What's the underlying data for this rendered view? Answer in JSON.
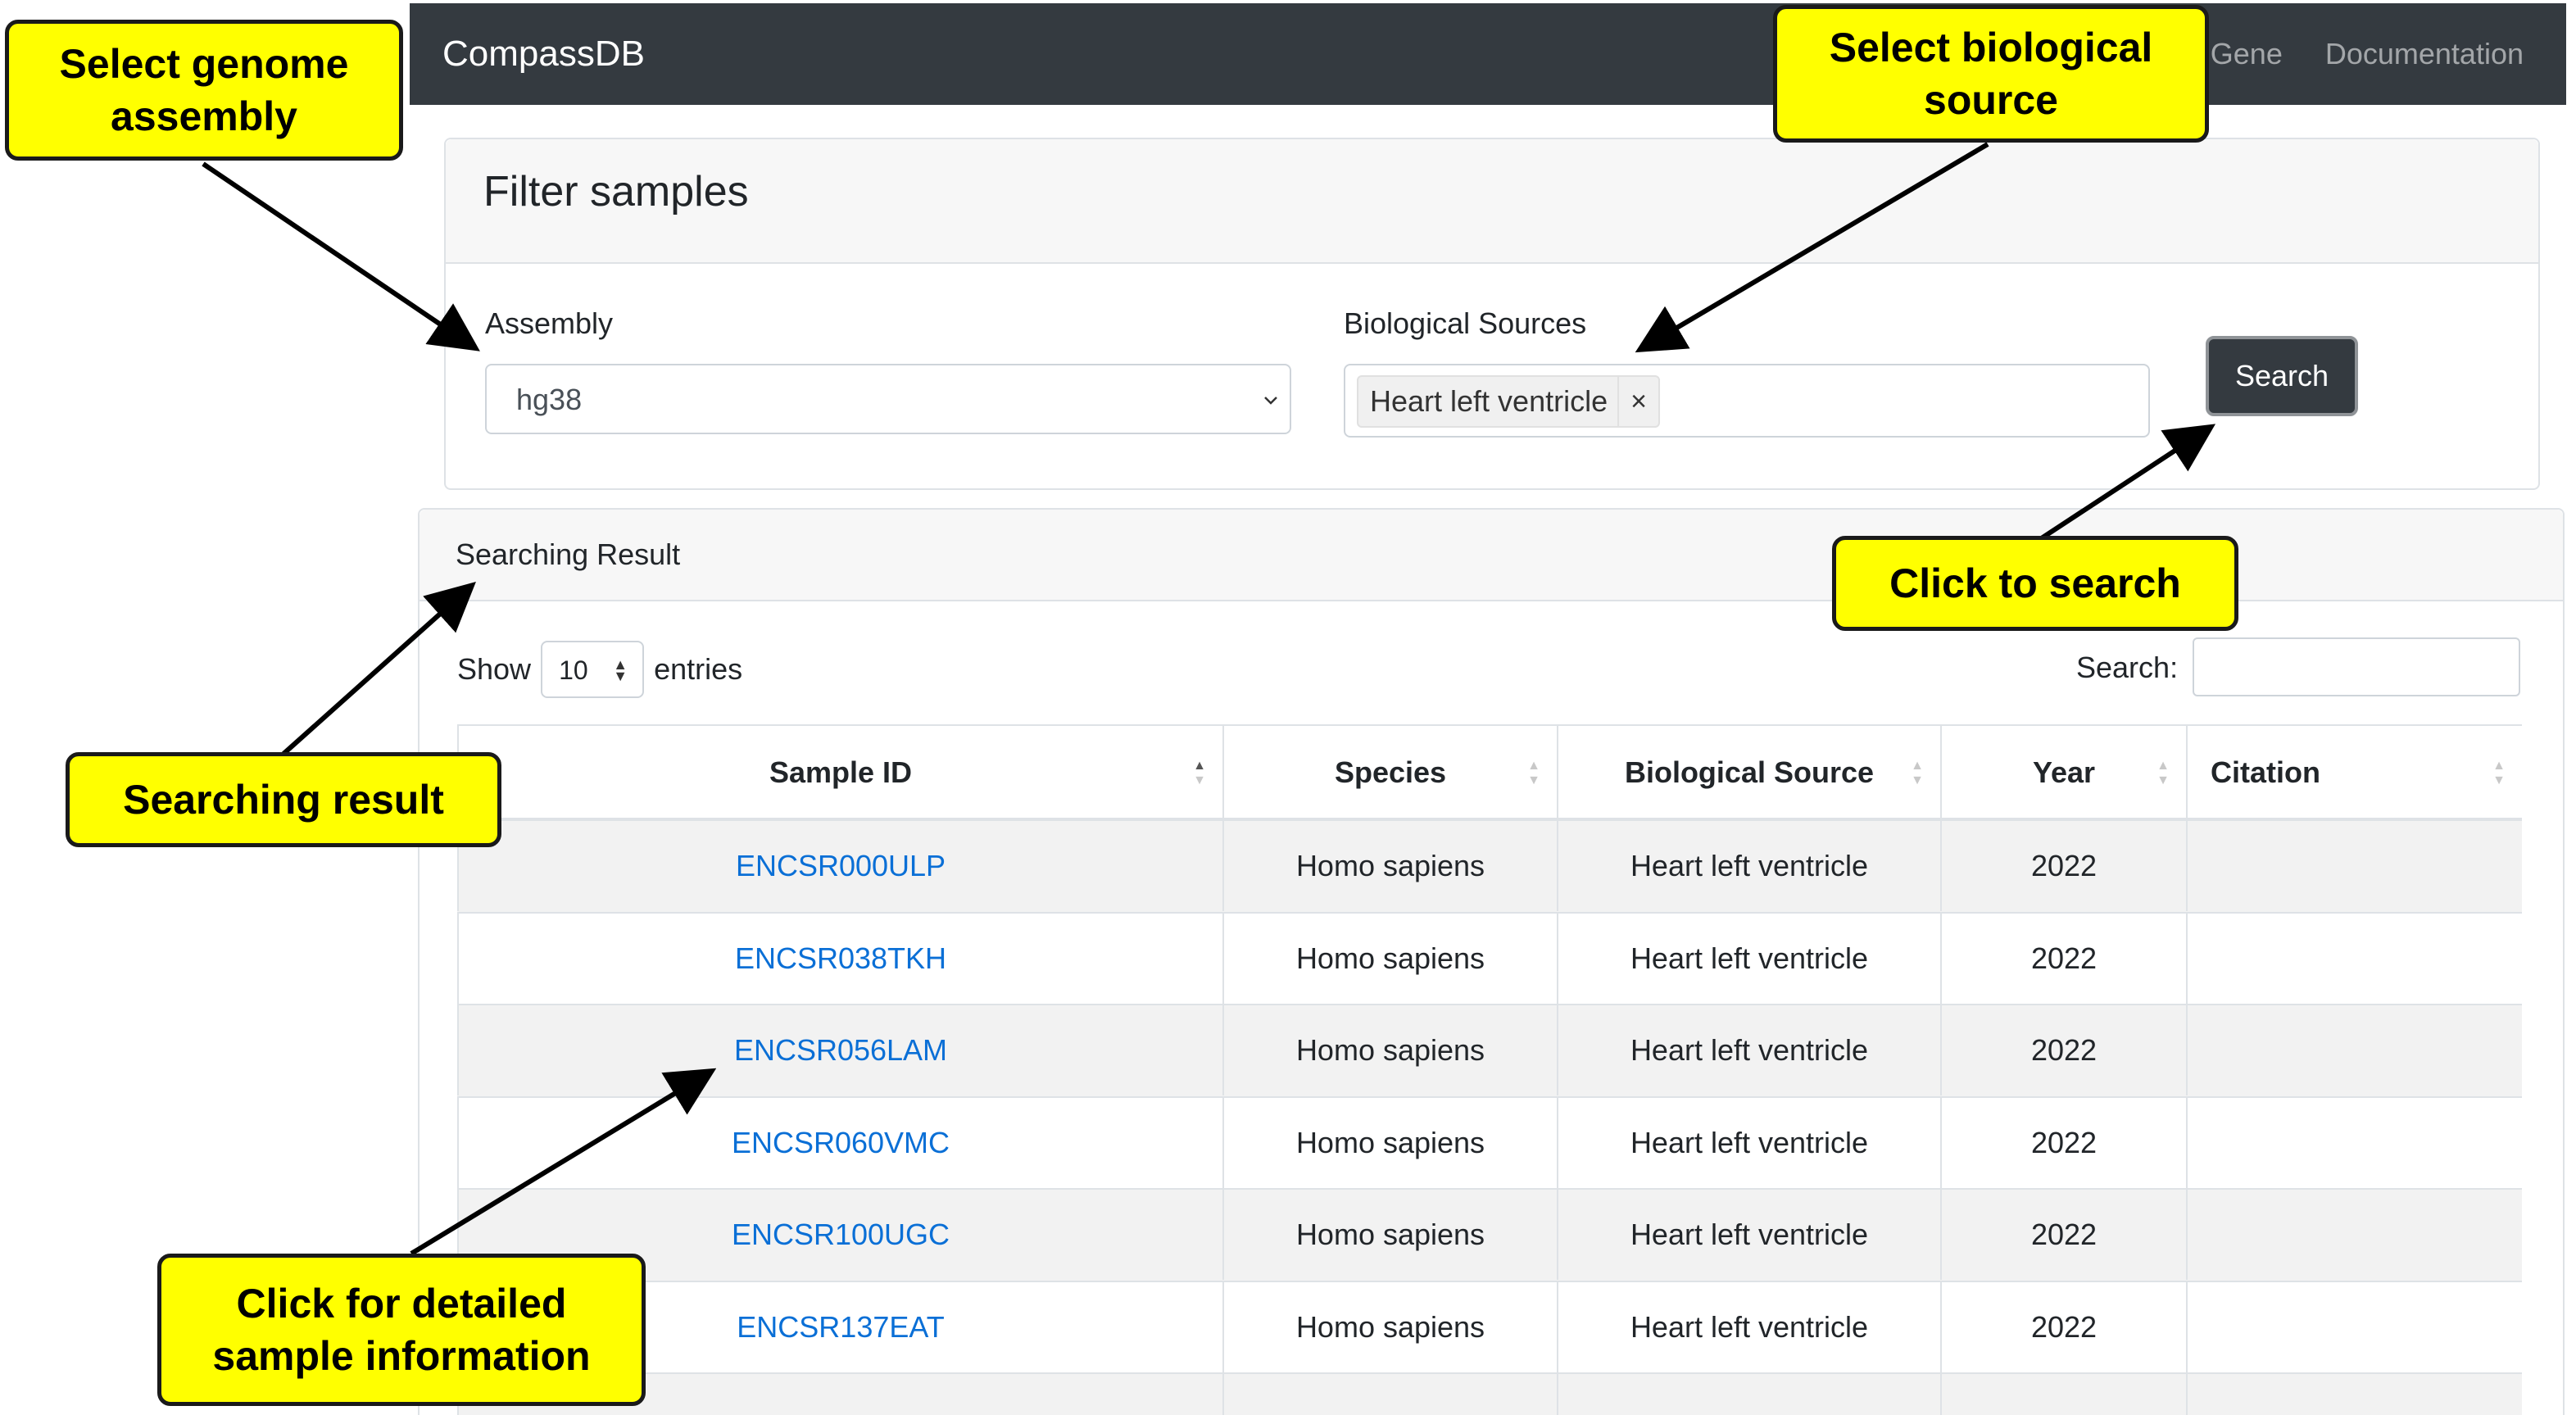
{
  "navbar": {
    "brand": "CompassDB",
    "links": [
      "Gene",
      "Documentation"
    ]
  },
  "filter": {
    "title": "Filter samples",
    "assembly_label": "Assembly",
    "assembly_value": "hg38",
    "sources_label": "Biological Sources",
    "selected_source": "Heart left ventricle",
    "remove_symbol": "×",
    "search_button": "Search"
  },
  "result": {
    "title": "Searching Result",
    "show_label": "Show",
    "page_length": "10",
    "entries_label": "entries",
    "search_label": "Search:",
    "columns": [
      "Sample ID",
      "Species",
      "Biological Source",
      "Year",
      "Citation"
    ],
    "rows": [
      {
        "sample_id": "ENCSR000ULP",
        "species": "Homo sapiens",
        "source": "Heart left ventricle",
        "year": "2022",
        "citation": ""
      },
      {
        "sample_id": "ENCSR038TKH",
        "species": "Homo sapiens",
        "source": "Heart left ventricle",
        "year": "2022",
        "citation": ""
      },
      {
        "sample_id": "ENCSR056LAM",
        "species": "Homo sapiens",
        "source": "Heart left ventricle",
        "year": "2022",
        "citation": ""
      },
      {
        "sample_id": "ENCSR060VMC",
        "species": "Homo sapiens",
        "source": "Heart left ventricle",
        "year": "2022",
        "citation": ""
      },
      {
        "sample_id": "ENCSR100UGC",
        "species": "Homo sapiens",
        "source": "Heart left ventricle",
        "year": "2022",
        "citation": ""
      },
      {
        "sample_id": "ENCSR137EAT",
        "species": "Homo sapiens",
        "source": "Heart left ventricle",
        "year": "2022",
        "citation": ""
      }
    ]
  },
  "callouts": {
    "assembly": "Select genome\nassembly",
    "source": "Select biological\nsource",
    "search": "Click to search",
    "result": "Searching result",
    "detail": "Click for detailed\nsample information"
  },
  "colors": {
    "navbar": "#343a40",
    "link": "#0a6fd6",
    "callout": "#ffff00"
  },
  "icons": [
    "chevron-down-icon",
    "sort-icon",
    "close-icon",
    "arrow-icon"
  ]
}
